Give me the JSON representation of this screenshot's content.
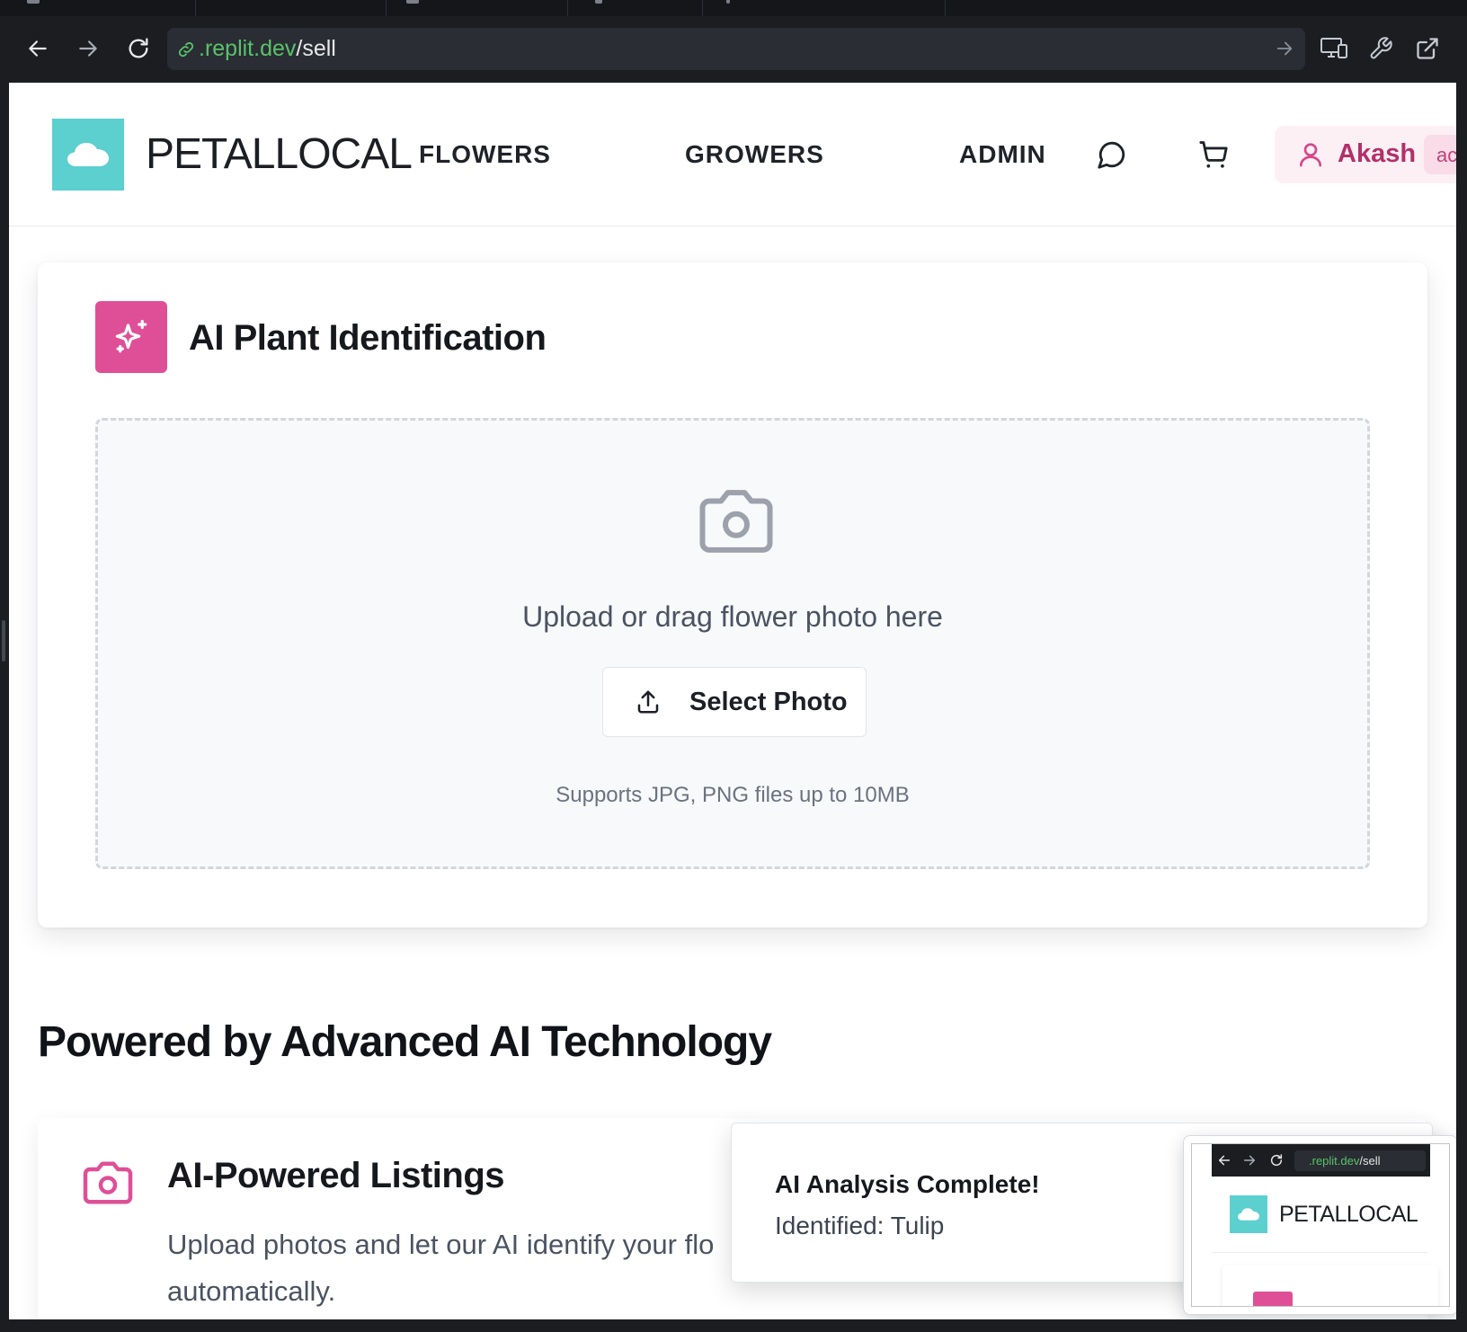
{
  "browser": {
    "url_domain": ".replit.dev",
    "url_path": "/sell"
  },
  "site": {
    "brand": "PETALLOCAL",
    "nav": {
      "flowers": "FLOWERS",
      "growers": "GROWERS",
      "admin": "ADMIN"
    },
    "user": {
      "name": "Akash",
      "role_badge": "ac"
    }
  },
  "ai_card": {
    "title": "AI Plant Identification",
    "drop_text": "Upload or drag flower photo here",
    "select_button": "Select Photo",
    "hint": "Supports JPG, PNG files up to 10MB"
  },
  "section": {
    "title": "Powered by Advanced AI Technology"
  },
  "feature": {
    "title": "AI-Powered Listings",
    "description_line1": "Upload photos and let our AI identify your flo",
    "description_line2": "automatically."
  },
  "toast": {
    "title": "AI Analysis Complete!",
    "body": "Identified: Tulip"
  },
  "pip": {
    "url_domain": ".replit.dev",
    "url_path": "/sell",
    "brand": "PETALLOCAL"
  },
  "colors": {
    "brand_teal": "#5ccfcf",
    "accent_pink": "#df4f97",
    "user_pink": "#b3306a",
    "url_green": "#58c26b"
  }
}
